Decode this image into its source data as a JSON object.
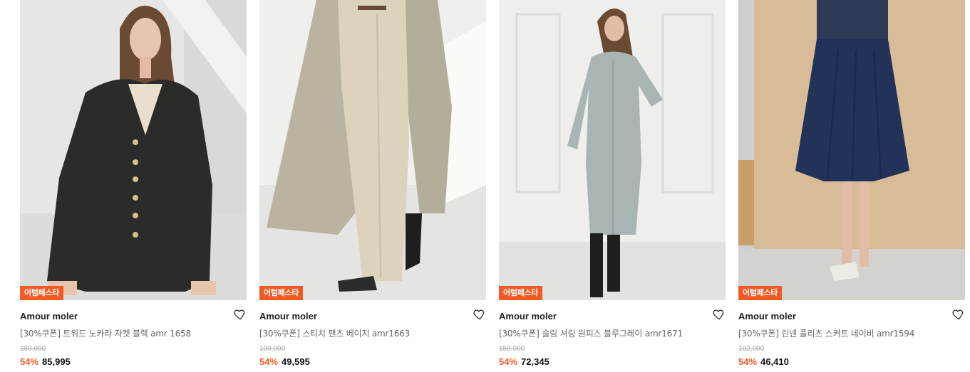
{
  "products": [
    {
      "badge": "어텀페스타",
      "brand": "Amour moler",
      "title": "[30%쿠폰] 트위드 노카라 자켓 블랙 amr 1658",
      "original_price": "189,000",
      "discount": "54%",
      "price": "85,995",
      "image": "product-photo-tweed-jacket-black"
    },
    {
      "badge": "어텀페스타",
      "brand": "Amour moler",
      "title": "[30%쿠폰] 스티치 팬츠 베이지 amr1663",
      "original_price": "109,000",
      "discount": "54%",
      "price": "49,595",
      "image": "product-photo-stitch-pants-beige"
    },
    {
      "badge": "어텀페스타",
      "brand": "Amour moler",
      "title": "[30%쿠폰] 슬림 셔링 원피스 블루그레이 amr1671",
      "original_price": "159,000",
      "discount": "54%",
      "price": "72,345",
      "image": "product-photo-shirring-dress-bluegray"
    },
    {
      "badge": "어텀페스타",
      "brand": "Amour moler",
      "title": "[30%쿠폰] 린넨 플리츠 스커트 네이비 amr1594",
      "original_price": "102,000",
      "discount": "54%",
      "price": "46,410",
      "image": "product-photo-linen-pleats-skirt-navy"
    }
  ],
  "colors": {
    "accent": "#f15a24",
    "text": "#222222",
    "muted": "#666666"
  },
  "icons": {
    "wishlist": "heart-icon"
  }
}
